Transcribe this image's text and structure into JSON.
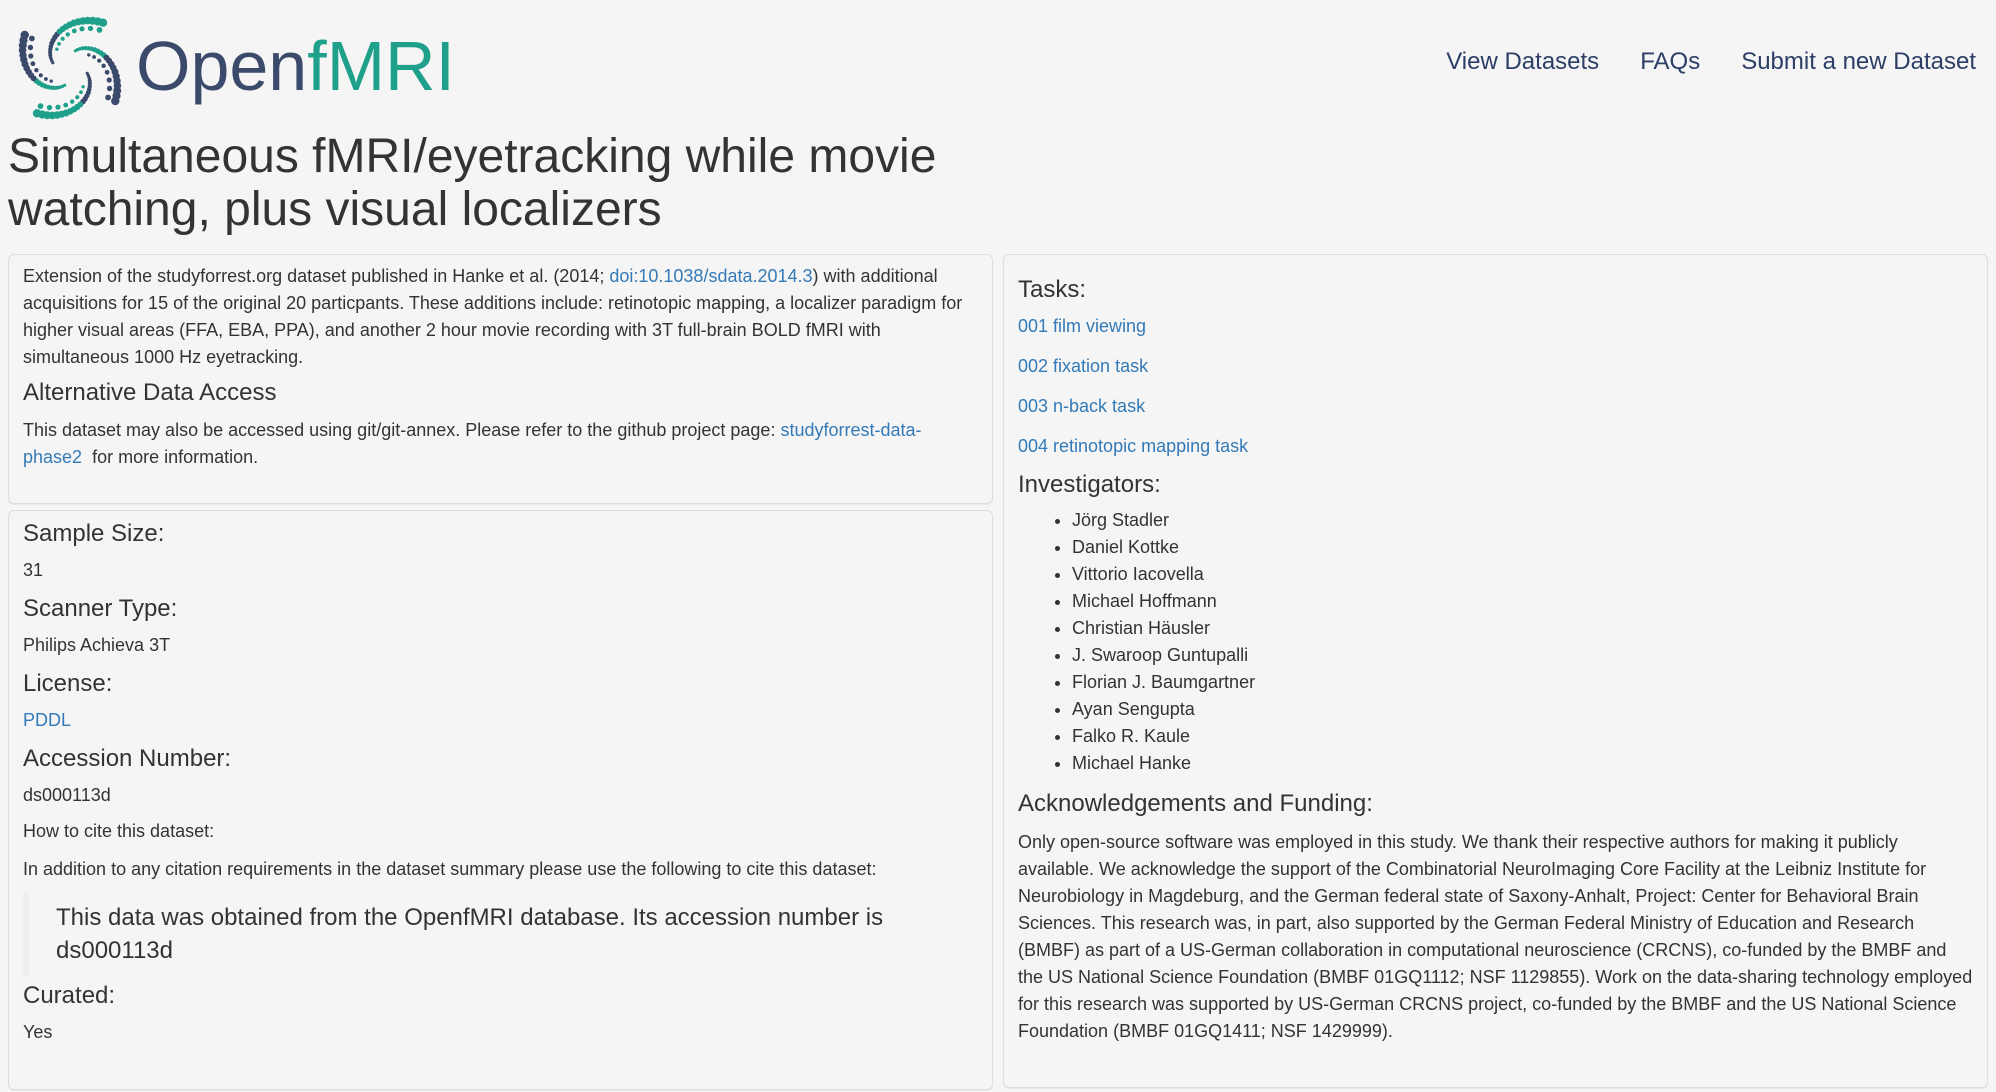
{
  "header": {
    "brand_open": "Open",
    "brand_fmri": "fMRI",
    "nav": [
      "View Datasets",
      "FAQs",
      "Submit a new Dataset"
    ]
  },
  "title": "Simultaneous fMRI/eyetracking while movie watching, plus visual localizers",
  "description": {
    "text_before": "Extension of the studyforrest.org dataset published in Hanke et al. (2014; ",
    "doi_link": "doi:10.1038/sdata.2014.3",
    "text_after": ") with additional acquisitions for 15 of the original 20 particpants. These additions include: retinotopic mapping, a localizer paradigm for higher visual areas (FFA, EBA, PPA), and another 2 hour movie recording with 3T full-brain BOLD fMRI with simultaneous 1000 Hz eyetracking.",
    "alt_heading": "Alternative Data Access",
    "alt_before": "This dataset may also be accessed using git/git-annex. Please refer to the github project page: ",
    "alt_link": "studyforrest-data-phase2",
    "alt_after": "  for more information."
  },
  "meta": {
    "sample_size_label": "Sample Size:",
    "sample_size": "31",
    "scanner_label": "Scanner Type:",
    "scanner": "Philips Achieva 3T",
    "license_label": "License:",
    "license": "PDDL",
    "accession_label": "Accession Number:",
    "accession": "ds000113d",
    "cite_label": "How to cite this dataset:",
    "cite_text": "In addition to any citation requirements in the dataset summary please use the following to cite this dataset:",
    "quote": "This data was obtained from the OpenfMRI database. Its accession number is ds000113d",
    "curated_label": "Curated:",
    "curated": "Yes"
  },
  "right": {
    "tasks_label": "Tasks:",
    "tasks": [
      "001 film viewing",
      "002 fixation task",
      "003 n-back task",
      "004 retinotopic mapping task"
    ],
    "investigators_label": "Investigators:",
    "investigators": [
      "Jörg Stadler",
      "Daniel Kottke",
      "Vittorio Iacovella",
      "Michael Hoffmann",
      "Christian Häusler",
      "J. Swaroop Guntupalli",
      "Florian J. Baumgartner",
      "Ayan Sengupta",
      "Falko R. Kaule",
      "Michael Hanke"
    ],
    "ack_label": "Acknowledgements and Funding:",
    "ack_text": "Only open-source software was employed in this study. We thank their respective authors for making it publicly available. We acknowledge the support of the Combinatorial NeuroImaging Core Facility at the Leibniz Institute for Neurobiology in Magdeburg, and the German federal state of Saxony-Anhalt, Project: Center for Behavioral Brain Sciences. This research was, in part, also supported by the German Federal Ministry of Education and Research (BMBF) as part of a US-German collaboration in computational neuroscience (CRCNS), co-funded by the BMBF and the US National Science Foundation (BMBF 01GQ1112; NSF 1129855). Work on the data-sharing technology employed for this research was supported by US-German CRCNS project, co-funded by the BMBF and the US National Science Foundation (BMBF 01GQ1411; NSF 1429999)."
  },
  "colors": {
    "brand_dark": "#3b4a6b",
    "brand_teal": "#1fa08a",
    "link": "#337ab7"
  }
}
